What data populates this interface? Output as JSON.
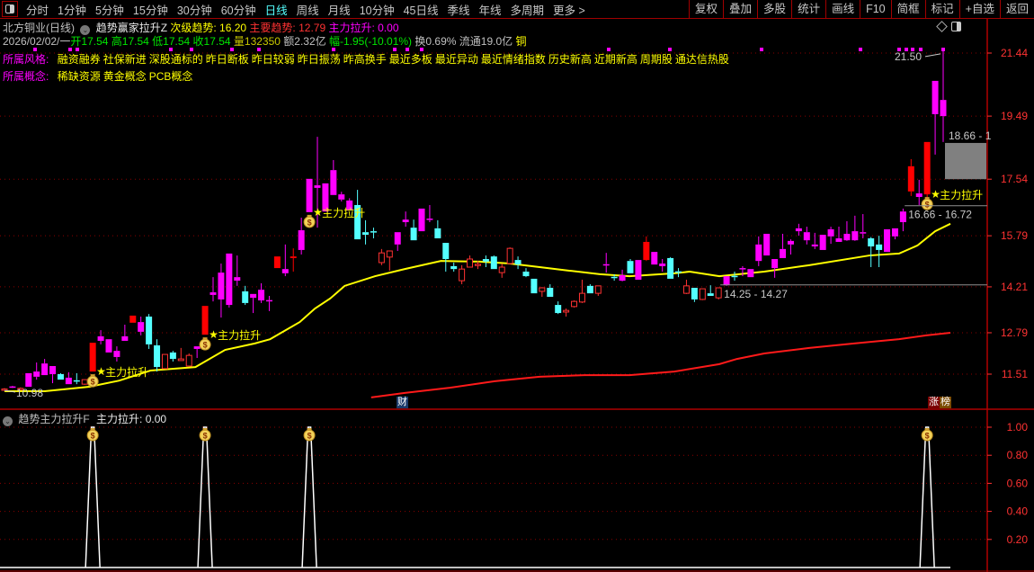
{
  "topbar": {
    "tabs": [
      "分时",
      "1分钟",
      "5分钟",
      "15分钟",
      "30分钟",
      "60分钟",
      "日线",
      "周线",
      "月线",
      "10分钟",
      "45日线",
      "季线",
      "年线",
      "多周期",
      "更多 >"
    ],
    "active_tab": "日线",
    "buttons": [
      "复权",
      "叠加",
      "多股",
      "统计",
      "画线",
      "F10",
      "简框",
      "标记",
      "+自选",
      "返回"
    ]
  },
  "header": {
    "stock": "北方铜业(日线)",
    "indicator": "趋势赢家拉升Z",
    "secondary_trend": "次级趋势: 16.20",
    "main_trend": "主要趋势: 12.79",
    "main_force": "主力拉升: 0.00"
  },
  "quote": {
    "date": "2026/02/02/一",
    "open": "开17.54",
    "high": "高17.54",
    "low": "低17.54",
    "close": "收17.54",
    "volume": "量132350",
    "amount": "额2.32亿",
    "change": "幅-1.95(-10.01%)",
    "turnover": "换0.69%",
    "float": "流通19.0亿",
    "sector": "铜"
  },
  "styles": {
    "label": "所属风格:",
    "tags": [
      "融资融券",
      "社保新进",
      "深股通标的",
      "昨日断板",
      "昨日较弱",
      "昨日振荡",
      "昨高换手",
      "最近多板",
      "最近异动",
      "最近情绪指数",
      "历史新高",
      "近期新高",
      "周期股",
      "通达信热股"
    ]
  },
  "concepts": {
    "label": "所属概念:",
    "tags": [
      "稀缺资源",
      "黄金概念",
      "PCB概念"
    ]
  },
  "badges": {
    "finance": "财",
    "rank_a": "涨",
    "rank_b": "榜"
  },
  "lower_panel": {
    "indicator": "趋势主力拉升F",
    "value": "主力拉升: 0.00"
  },
  "colors": {
    "up_hollow": "#ff3232",
    "up_solid": "#ff0000",
    "down": "#54ffff",
    "highlight": "#ff00ff",
    "ma_secondary": "#ffff00",
    "ma_main": "#ff1a1a",
    "axis": "#ff3232",
    "signal": "#ffffff"
  },
  "chart_data": [
    {
      "type": "candlestick",
      "y_ticks": [
        "21.44",
        "19.49",
        "17.54",
        "15.79",
        "14.21",
        "12.79",
        "11.51"
      ],
      "candle_fields": [
        "open",
        "high",
        "low",
        "close",
        "style"
      ],
      "candles": [
        [
          11.04,
          11.08,
          10.98,
          11.05,
          "r"
        ],
        [
          11.1,
          11.15,
          11.08,
          11.13,
          "m"
        ],
        [
          11.04,
          11.1,
          11.02,
          11.07,
          "r"
        ],
        [
          11.12,
          11.54,
          11.12,
          11.54,
          "m"
        ],
        [
          11.43,
          11.87,
          11.34,
          11.59,
          "m"
        ],
        [
          11.48,
          11.98,
          11.48,
          11.84,
          "m"
        ],
        [
          11.51,
          11.76,
          11.23,
          11.76,
          "m"
        ],
        [
          11.51,
          11.54,
          11.34,
          11.34,
          "c"
        ],
        [
          11.2,
          11.57,
          11.2,
          11.4,
          "m"
        ],
        [
          11.32,
          11.54,
          11.2,
          11.31,
          "c"
        ],
        [
          11.2,
          11.34,
          11.18,
          11.34,
          "r"
        ],
        [
          11.59,
          12.48,
          11.59,
          12.48,
          "R"
        ],
        [
          12.54,
          12.87,
          12.43,
          12.68,
          "m"
        ],
        [
          12.18,
          12.59,
          12.18,
          12.59,
          "m"
        ],
        [
          12.04,
          12.37,
          11.9,
          12.23,
          "m"
        ],
        [
          12.54,
          13.04,
          12.54,
          12.68,
          "m"
        ],
        [
          13.1,
          13.32,
          13.1,
          13.32,
          "R"
        ],
        [
          12.82,
          13.29,
          12.71,
          13.12,
          "m"
        ],
        [
          13.29,
          13.37,
          12.29,
          12.43,
          "c"
        ],
        [
          12.4,
          12.59,
          11.59,
          11.73,
          "c"
        ],
        [
          11.68,
          12.12,
          11.68,
          12.12,
          "r"
        ],
        [
          12.18,
          12.23,
          11.9,
          11.98,
          "c"
        ],
        [
          11.93,
          12.32,
          11.93,
          11.98,
          "r"
        ],
        [
          11.76,
          12.15,
          11.76,
          12.09,
          "r"
        ],
        [
          12.29,
          12.37,
          12.01,
          12.37,
          "m"
        ],
        [
          12.73,
          13.62,
          12.73,
          13.62,
          "R"
        ],
        [
          13.96,
          14.51,
          13.76,
          14.04,
          "m"
        ],
        [
          13.82,
          14.93,
          13.26,
          14.65,
          "m"
        ],
        [
          13.65,
          15.24,
          13.57,
          15.24,
          "m"
        ],
        [
          14.4,
          15.18,
          14.24,
          14.51,
          "m"
        ],
        [
          14.07,
          14.24,
          13.65,
          13.71,
          "c"
        ],
        [
          13.87,
          13.99,
          13.4,
          13.99,
          "m"
        ],
        [
          13.79,
          14.32,
          13.71,
          14.12,
          "m"
        ],
        [
          13.79,
          13.93,
          13.46,
          13.8,
          "m"
        ],
        [
          14.79,
          15.15,
          14.79,
          15.15,
          "R"
        ],
        [
          14.63,
          15.52,
          14.54,
          14.76,
          "m"
        ],
        [
          15.1,
          15.4,
          14.68,
          15.15,
          "R"
        ],
        [
          15.35,
          16.35,
          15.21,
          15.96,
          "m"
        ],
        [
          16.52,
          17.55,
          16.52,
          17.55,
          "m"
        ],
        [
          17.27,
          18.85,
          16.04,
          17.35,
          "m"
        ],
        [
          16.54,
          17.41,
          16.54,
          17.41,
          "m"
        ],
        [
          17.05,
          18.13,
          17.05,
          17.82,
          "m"
        ],
        [
          16.91,
          17.15,
          16.85,
          17.07,
          "m"
        ],
        [
          16.57,
          16.95,
          16.57,
          16.88,
          "m"
        ],
        [
          16.74,
          17.21,
          15.68,
          15.68,
          "c"
        ],
        [
          15.9,
          16.27,
          15.52,
          15.82,
          "c"
        ],
        [
          15.93,
          16.04,
          15.71,
          15.91,
          "c"
        ],
        [
          14.96,
          15.38,
          14.88,
          15.26,
          "r"
        ],
        [
          15.13,
          15.32,
          14.71,
          15.32,
          "r"
        ],
        [
          15.52,
          15.9,
          15.32,
          15.9,
          "m"
        ],
        [
          16.21,
          16.54,
          16.07,
          16.29,
          "m"
        ],
        [
          16.04,
          16.29,
          15.65,
          15.65,
          "c"
        ],
        [
          15.93,
          16.63,
          15.93,
          16.63,
          "m"
        ],
        [
          16.3,
          16.74,
          16.21,
          16.32,
          "m"
        ],
        [
          16.02,
          16.27,
          15.71,
          15.71,
          "c"
        ],
        [
          15.57,
          15.57,
          14.68,
          15.07,
          "c"
        ],
        [
          14.85,
          14.96,
          14.68,
          14.76,
          "c"
        ],
        [
          14.4,
          14.88,
          14.29,
          14.76,
          "r"
        ],
        [
          14.82,
          15.18,
          14.82,
          15.07,
          "r"
        ],
        [
          14.89,
          15.01,
          14.76,
          14.91,
          "r"
        ],
        [
          15.07,
          15.18,
          14.82,
          14.99,
          "c"
        ],
        [
          15.15,
          15.18,
          14.76,
          14.76,
          "c"
        ],
        [
          14.65,
          14.93,
          14.49,
          14.82,
          "r"
        ],
        [
          14.93,
          15.43,
          14.9,
          15.4,
          "r"
        ],
        [
          15.04,
          15.15,
          14.76,
          14.9,
          "c"
        ],
        [
          14.68,
          14.79,
          14.51,
          14.54,
          "c"
        ],
        [
          14.46,
          14.46,
          14.01,
          14.01,
          "c"
        ],
        [
          14.07,
          14.2,
          13.9,
          14.18,
          "r"
        ],
        [
          14.18,
          14.29,
          13.9,
          13.9,
          "c"
        ],
        [
          13.65,
          13.76,
          13.37,
          13.4,
          "c"
        ],
        [
          13.43,
          13.54,
          13.29,
          13.48,
          "r"
        ],
        [
          13.6,
          13.79,
          13.57,
          13.76,
          "r"
        ],
        [
          13.74,
          14.43,
          13.71,
          14.01,
          "r"
        ],
        [
          14.24,
          14.29,
          14.01,
          14.01,
          "c"
        ],
        [
          14.01,
          14.24,
          13.93,
          14.24,
          "r"
        ],
        [
          14.89,
          15.26,
          14.65,
          14.91,
          "m"
        ],
        [
          14.52,
          14.6,
          14.4,
          14.5,
          "c"
        ],
        [
          14.4,
          14.74,
          14.38,
          14.57,
          "m"
        ],
        [
          15.01,
          15.07,
          14.63,
          14.63,
          "c"
        ],
        [
          14.43,
          15.04,
          14.43,
          15.04,
          "m"
        ],
        [
          15.04,
          15.77,
          15.01,
          15.6,
          "R"
        ],
        [
          14.9,
          15.29,
          14.9,
          15.29,
          "m"
        ],
        [
          14.85,
          15.07,
          14.68,
          14.93,
          "m"
        ],
        [
          15.1,
          15.13,
          14.46,
          14.46,
          "c"
        ],
        [
          14.69,
          14.79,
          14.51,
          14.68,
          "c"
        ],
        [
          14.01,
          14.43,
          13.99,
          14.24,
          "r"
        ],
        [
          14.18,
          14.18,
          13.74,
          13.82,
          "c"
        ],
        [
          13.82,
          14.15,
          13.8,
          14.15,
          "r"
        ],
        [
          14.01,
          14.26,
          13.93,
          13.93,
          "c"
        ],
        [
          13.87,
          14.18,
          13.82,
          14.18,
          "r"
        ],
        [
          14.26,
          14.54,
          14.24,
          14.54,
          "m"
        ],
        [
          14.55,
          14.68,
          14.4,
          14.54,
          "c"
        ],
        [
          14.78,
          14.85,
          14.54,
          14.79,
          "m"
        ],
        [
          14.51,
          14.76,
          14.51,
          14.76,
          "m"
        ],
        [
          15.01,
          15.77,
          14.85,
          15.52,
          "m"
        ],
        [
          15.18,
          15.85,
          15.18,
          15.85,
          "m"
        ],
        [
          14.79,
          15.07,
          14.49,
          15.07,
          "m"
        ],
        [
          15.1,
          15.85,
          15.1,
          15.38,
          "m"
        ],
        [
          15.52,
          15.68,
          15.21,
          15.63,
          "m"
        ],
        [
          15.93,
          16.16,
          15.79,
          16.02,
          "m"
        ],
        [
          15.65,
          16.07,
          15.52,
          15.9,
          "m"
        ],
        [
          15.46,
          15.88,
          15.38,
          15.52,
          "m"
        ],
        [
          15.35,
          15.82,
          15.35,
          15.82,
          "m"
        ],
        [
          15.77,
          16.07,
          15.54,
          15.99,
          "m"
        ],
        [
          15.6,
          16.07,
          15.6,
          15.71,
          "m"
        ],
        [
          15.65,
          16.24,
          15.63,
          15.85,
          "m"
        ],
        [
          15.65,
          16.41,
          15.63,
          15.93,
          "m"
        ],
        [
          15.88,
          16.46,
          15.71,
          15.9,
          "m"
        ],
        [
          15.71,
          15.75,
          14.82,
          15.46,
          "c"
        ],
        [
          15.52,
          15.79,
          14.82,
          15.35,
          "c"
        ],
        [
          15.29,
          15.99,
          15.29,
          15.99,
          "m"
        ],
        [
          15.77,
          16.02,
          15.68,
          16.02,
          "m"
        ],
        [
          16.21,
          16.63,
          15.93,
          16.54,
          "m"
        ],
        [
          17.16,
          18.16,
          17.02,
          17.94,
          "R"
        ],
        [
          16.99,
          17.52,
          16.74,
          17.1,
          "m"
        ],
        [
          17.07,
          18.69,
          16.88,
          18.69,
          "R"
        ],
        [
          19.55,
          20.58,
          18.3,
          20.58,
          "m"
        ],
        [
          19.49,
          21.5,
          18.69,
          19.99,
          "m"
        ]
      ],
      "secondary_trend_line": [
        [
          0,
          10.98
        ],
        [
          5,
          10.98
        ],
        [
          10.6,
          11.12
        ],
        [
          14.3,
          11.31
        ],
        [
          18.2,
          11.62
        ],
        [
          23.8,
          11.73
        ],
        [
          27.5,
          12.26
        ],
        [
          31.2,
          12.46
        ],
        [
          33.1,
          12.59
        ],
        [
          36.8,
          13.12
        ],
        [
          38.7,
          13.54
        ],
        [
          40.6,
          13.85
        ],
        [
          42.4,
          14.24
        ],
        [
          46.2,
          14.54
        ],
        [
          49.9,
          14.76
        ],
        [
          54.4,
          15.01
        ],
        [
          59.2,
          14.99
        ],
        [
          63,
          14.93
        ],
        [
          66.7,
          14.82
        ],
        [
          70.4,
          14.71
        ],
        [
          74.2,
          14.6
        ],
        [
          77.9,
          14.54
        ],
        [
          83.5,
          14.63
        ],
        [
          85.4,
          14.68
        ],
        [
          89.1,
          14.54
        ],
        [
          94.7,
          14.68
        ],
        [
          100.3,
          14.88
        ],
        [
          107.8,
          15.18
        ],
        [
          111.5,
          15.24
        ],
        [
          113.8,
          15.49
        ],
        [
          116,
          15.93
        ],
        [
          117.9,
          16.16
        ]
      ],
      "main_trend_line": [
        [
          45.7,
          10.79
        ],
        [
          49.9,
          10.93
        ],
        [
          55.5,
          11.09
        ],
        [
          61.1,
          11.29
        ],
        [
          66.7,
          11.43
        ],
        [
          72.3,
          11.48
        ],
        [
          77.9,
          11.48
        ],
        [
          83.5,
          11.59
        ],
        [
          89.1,
          11.82
        ],
        [
          91.3,
          11.98
        ],
        [
          94.7,
          12.15
        ],
        [
          100.3,
          12.32
        ],
        [
          105.9,
          12.46
        ],
        [
          111.5,
          12.59
        ],
        [
          114.9,
          12.71
        ],
        [
          117.9,
          12.79
        ]
      ],
      "signals": {
        "label": "主力拉升",
        "indices": [
          11,
          25,
          38,
          115
        ]
      },
      "annotations": {
        "high_label": "21.50",
        "high_value": 21.5,
        "high_index": 117,
        "low_label": "10.98",
        "low_value": 10.98,
        "low_index": 0,
        "range_upper": "18.66 - 1",
        "box_range": [
          17.54,
          18.66
        ],
        "range_mid": "16.66 - 16.72",
        "range_mid_value": 16.72,
        "range_mid_index": 114,
        "range_low": "14.25 - 14.27",
        "range_low_value": 14.27,
        "range_low_index": 89
      }
    },
    {
      "type": "line",
      "y_ticks": [
        "1.00",
        "0.80",
        "0.60",
        "0.40",
        "0.20"
      ],
      "ylim": [
        0,
        1
      ],
      "series_label": "主力拉升",
      "signal_indices": [
        11,
        25,
        38,
        115
      ],
      "signal_value": 1
    }
  ]
}
